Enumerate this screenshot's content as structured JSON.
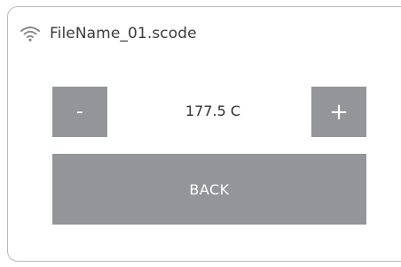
{
  "header": {
    "icon": "wifi-icon",
    "file_name": "FileName_01.scode"
  },
  "temperature": {
    "decrement_label": "-",
    "value": "177.5 C",
    "increment_label": "+"
  },
  "actions": {
    "back_label": "BACK"
  },
  "colors": {
    "button_bg": "#939598",
    "button_text": "#ffffff",
    "text": "#3a3a3a",
    "border": "#b9b9b9",
    "icon": "#8a8a8a"
  }
}
